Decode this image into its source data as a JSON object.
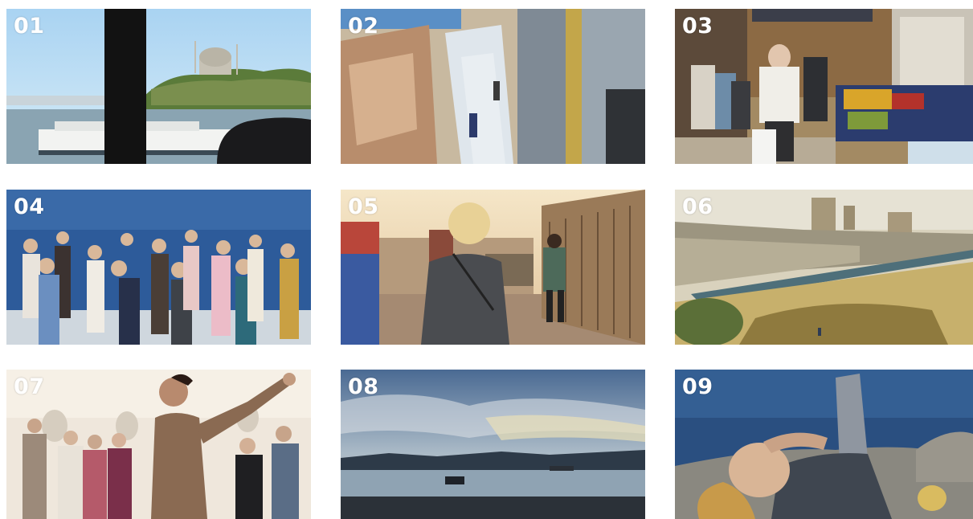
{
  "photos": [
    {
      "number": "01"
    },
    {
      "number": "02"
    },
    {
      "number": "03"
    },
    {
      "number": "04"
    },
    {
      "number": "05"
    },
    {
      "number": "06"
    },
    {
      "number": "07"
    },
    {
      "number": "08"
    },
    {
      "number": "09"
    }
  ],
  "colors": {
    "label": "#ffffff",
    "background": "#ffffff"
  }
}
